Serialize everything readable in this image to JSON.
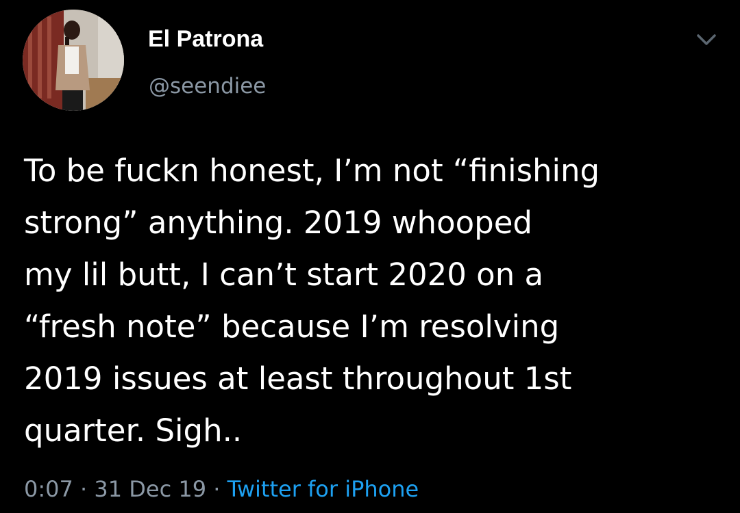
{
  "user": {
    "display_name": "El Patrona",
    "handle": "@seendiee"
  },
  "tweet": {
    "lines": [
      "To be fuckn honest, I’m not “finishing",
      "strong” anything. 2019 whooped",
      "my lil butt, I can’t start 2020 on a",
      "“fresh note” because I’m resolving",
      "2019 issues at least throughout 1st",
      "quarter. Sigh.."
    ],
    "time": "0:07",
    "separator": "·",
    "date": "31 Dec 19",
    "source": "Twitter for iPhone"
  },
  "icons": {
    "menu": "chevron-down-icon"
  },
  "colors": {
    "background": "#000000",
    "text": "#ffffff",
    "muted": "#8b98a5",
    "link": "#1da1f2"
  }
}
